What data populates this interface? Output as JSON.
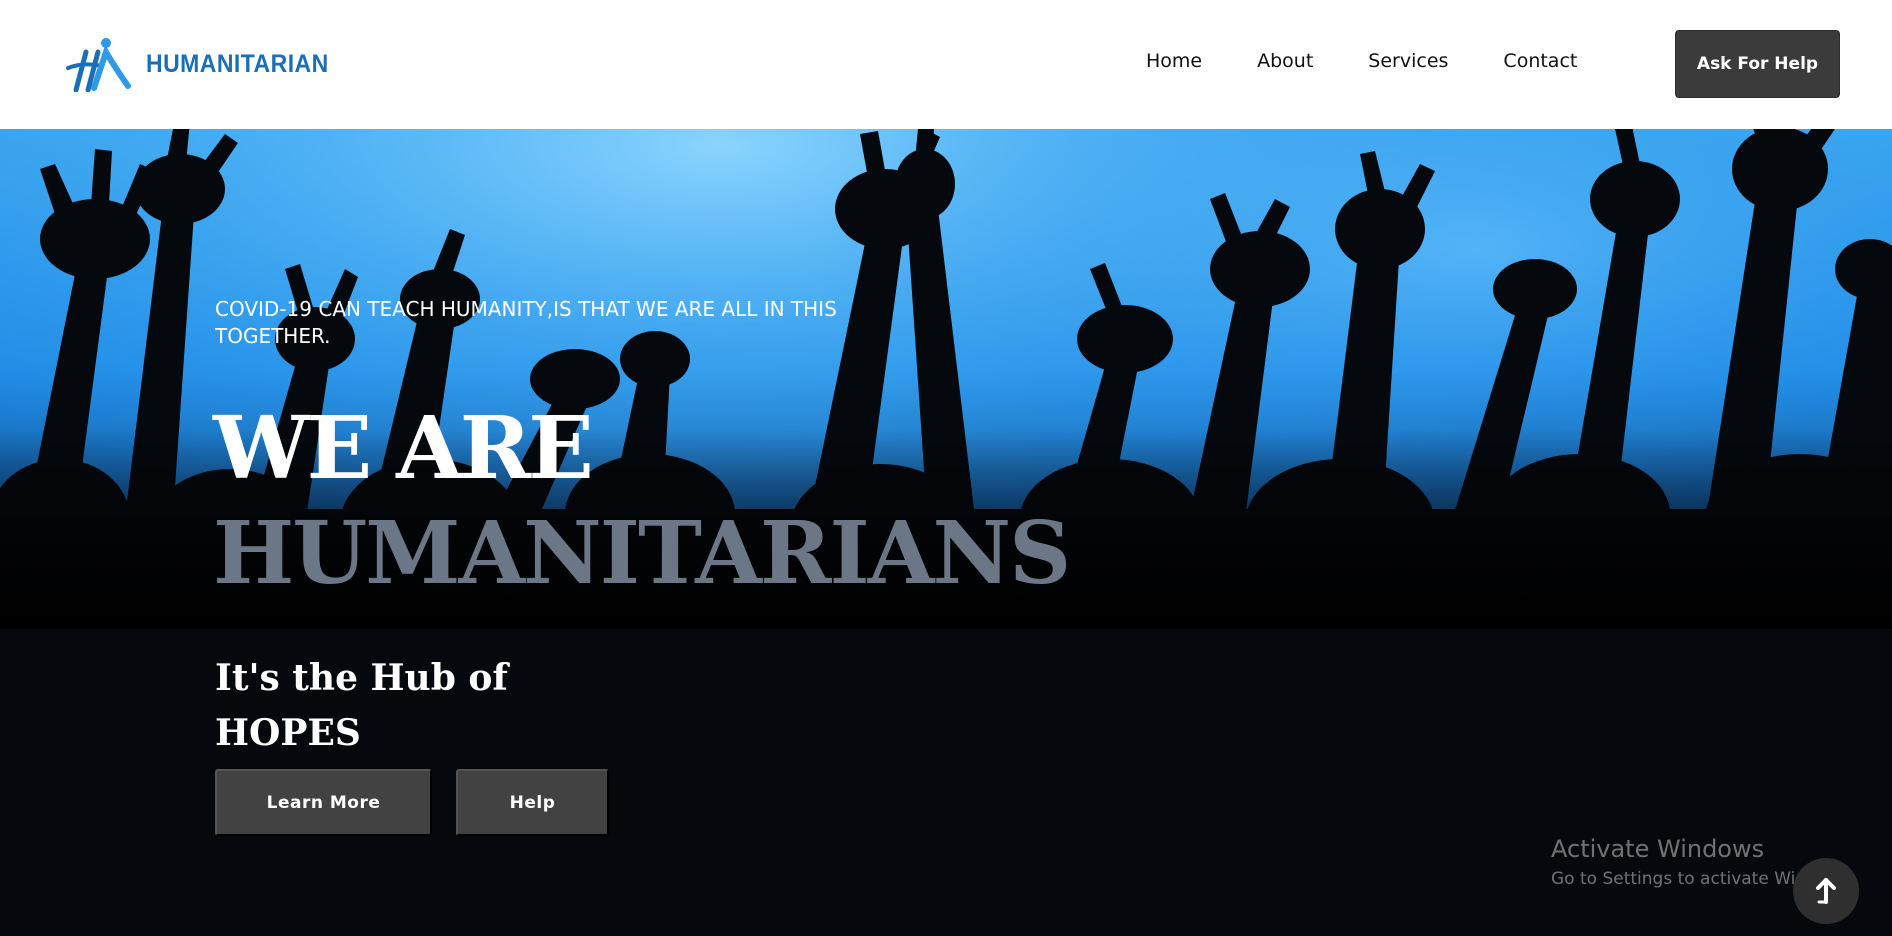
{
  "header": {
    "brand": "HUMANITARIAN",
    "nav": [
      "Home",
      "About",
      "Services",
      "Contact"
    ],
    "cta": "Ask For Help"
  },
  "hero": {
    "tagline": "COVID-19 CAN TEACH HUMANITY,IS THAT WE ARE ALL IN THIS TOGETHER.",
    "headline_line1": "WE ARE",
    "headline_line2": "HUMANITARIANS",
    "sub_line1": "It's the Hub of",
    "sub_line2": "HOPES",
    "buttons": {
      "learn_more": "Learn More",
      "help": "Help"
    }
  },
  "watermark": {
    "title": "Activate Windows",
    "subtitle": "Go to Settings to activate Windows."
  },
  "icons": {
    "logo": "humanitarian-logo-icon",
    "scroll_top": "arrow-up-icon"
  },
  "colors": {
    "brand_blue": "#1b6fb8",
    "button_dark": "#424242",
    "headline_gray": "#6b7686"
  }
}
